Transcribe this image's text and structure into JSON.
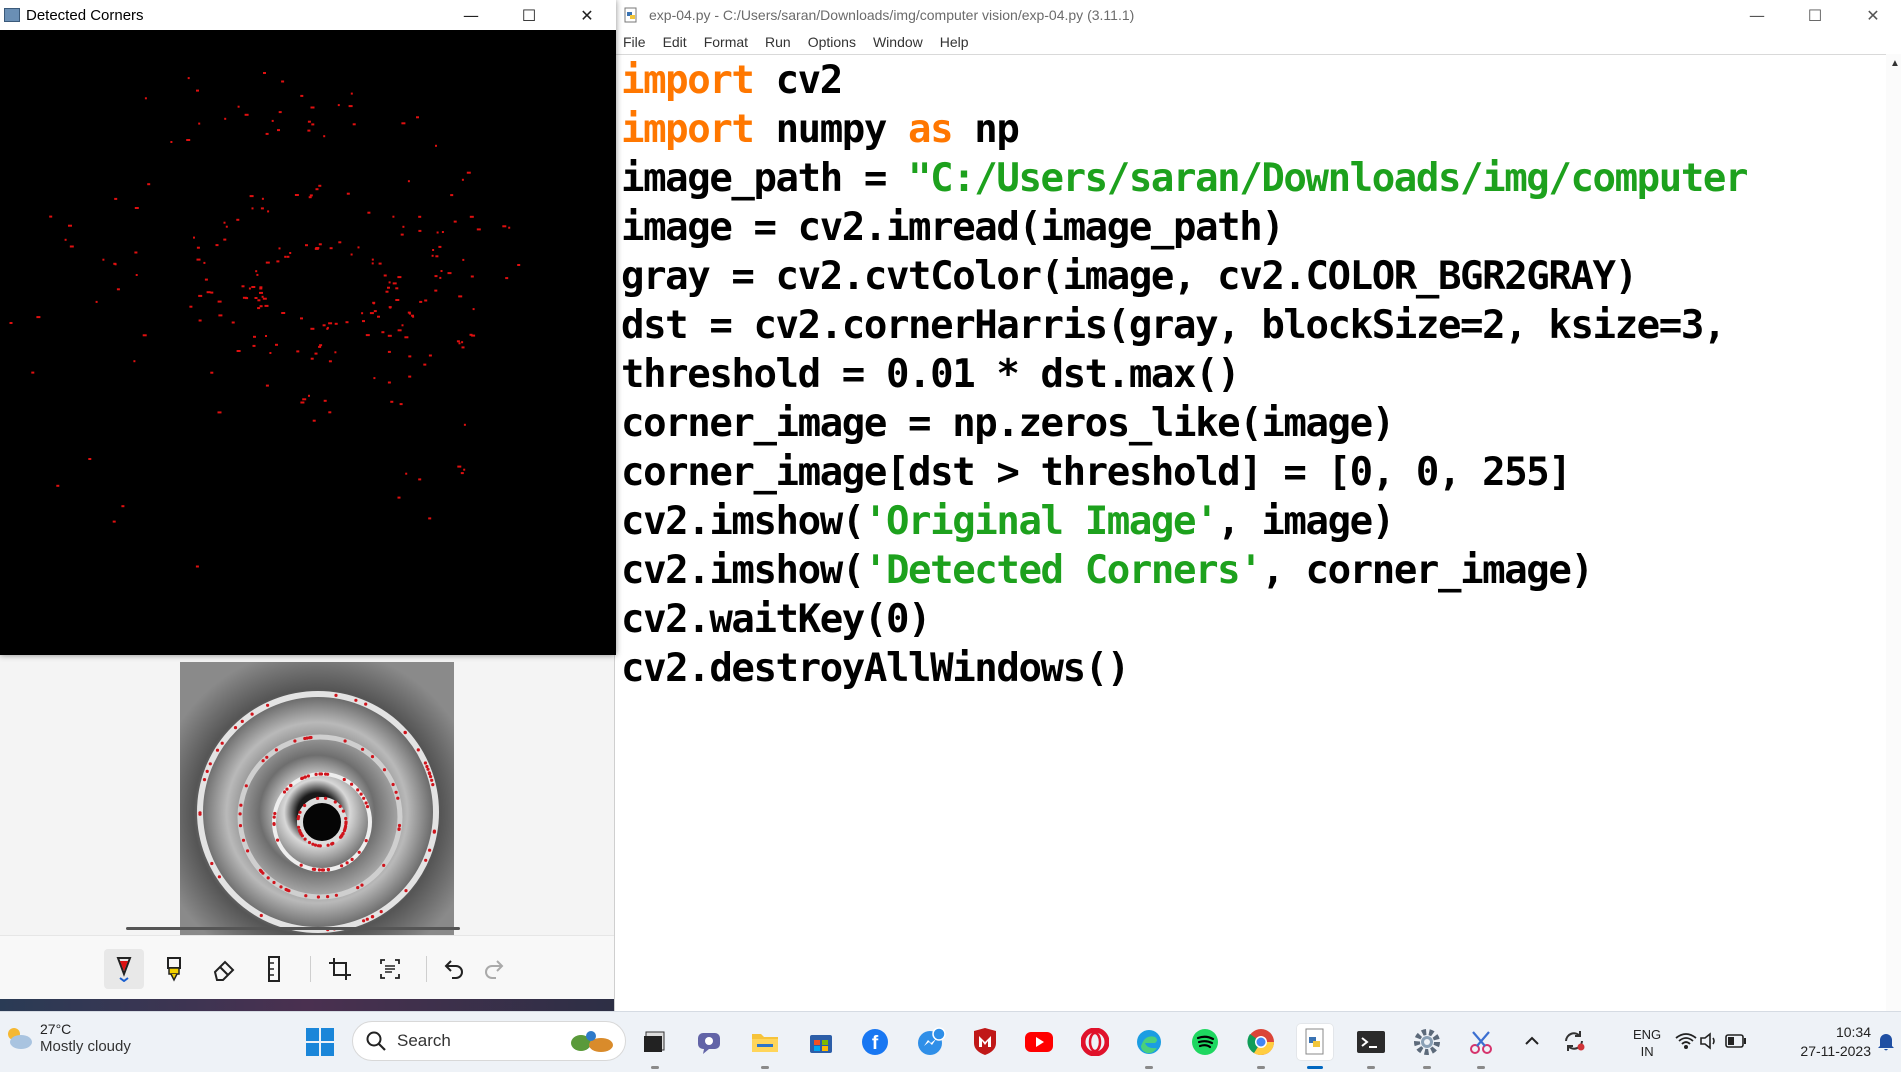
{
  "detected_window": {
    "title": "Detected Corners",
    "controls": {
      "minimize": "—",
      "maximize": "☐",
      "close": "✕"
    }
  },
  "idle_window": {
    "title": "exp-04.py - C:/Users/saran/Downloads/img/computer vision/exp-04.py (3.11.1)",
    "controls": {
      "minimize": "—",
      "maximize": "☐",
      "close": "✕"
    },
    "menu": [
      "File",
      "Edit",
      "Format",
      "Run",
      "Options",
      "Window",
      "Help"
    ],
    "code": [
      [
        {
          "t": "import",
          "c": "kw"
        },
        {
          "t": " cv2",
          "c": ""
        }
      ],
      [
        {
          "t": "import",
          "c": "kw"
        },
        {
          "t": " numpy ",
          "c": ""
        },
        {
          "t": "as",
          "c": "kw"
        },
        {
          "t": " np",
          "c": ""
        }
      ],
      [
        {
          "t": "image_path = ",
          "c": ""
        },
        {
          "t": "\"C:/Users/saran/Downloads/img/computer",
          "c": "str"
        }
      ],
      [
        {
          "t": "image = cv2.imread(image_path)",
          "c": ""
        }
      ],
      [
        {
          "t": "gray = cv2.cvtColor(image, cv2.COLOR_BGR2GRAY)",
          "c": ""
        }
      ],
      [
        {
          "t": "dst = cv2.cornerHarris(gray, blockSize=2, ksize=3,",
          "c": ""
        }
      ],
      [
        {
          "t": "threshold = 0.01 * dst.max()",
          "c": ""
        }
      ],
      [
        {
          "t": "corner_image = np.zeros_like(image)",
          "c": ""
        }
      ],
      [
        {
          "t": "corner_image[dst > threshold] = [0, 0, 255]",
          "c": ""
        }
      ],
      [
        {
          "t": "cv2.imshow(",
          "c": ""
        },
        {
          "t": "'Original Image'",
          "c": "str"
        },
        {
          "t": ", image)",
          "c": ""
        }
      ],
      [
        {
          "t": "cv2.imshow(",
          "c": ""
        },
        {
          "t": "'Detected Corners'",
          "c": "str"
        },
        {
          "t": ", corner_image)",
          "c": ""
        }
      ],
      [
        {
          "t": "cv2.waitKey(0)",
          "c": ""
        }
      ],
      [
        {
          "t": "cv2.destroyAllWindows()",
          "c": ""
        }
      ]
    ],
    "colors": {
      "keyword": "#ff7700",
      "string": "#1da11d"
    }
  },
  "snipping_toolbar": {
    "tools": [
      "ballpoint-pen-icon",
      "highlighter-icon",
      "eraser-icon",
      "ruler-icon",
      "crop-icon",
      "text-actions-icon",
      "undo-icon",
      "redo-icon"
    ]
  },
  "taskbar": {
    "weather": {
      "temp": "27°C",
      "condition": "Mostly cloudy"
    },
    "search_label": "Search",
    "apps": [
      "file-explorer-icon",
      "teams-icon",
      "folder-icon",
      "store-icon",
      "facebook-icon",
      "messenger-icon",
      "mcafee-icon",
      "youtube-icon",
      "opera-icon",
      "edge-icon",
      "spotify-icon",
      "chrome-icon",
      "python-idle-icon",
      "terminal-icon",
      "settings-icon",
      "snipping-tool-icon"
    ],
    "tray": {
      "lang_top": "ENG",
      "lang_bottom": "IN",
      "time": "10:34",
      "date": "27-11-2023"
    }
  }
}
